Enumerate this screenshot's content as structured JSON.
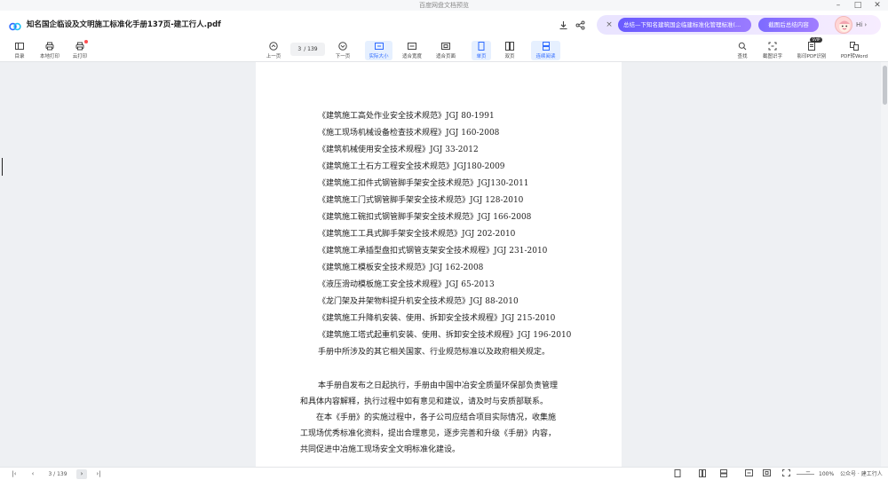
{
  "window": {
    "title": "百度网盘文档预览",
    "controls": [
      "–",
      "□",
      "✕"
    ]
  },
  "header": {
    "doc_title": "知名国企临设及文明施工标准化手册137页-建工行人.pdf",
    "download_icon": "download-icon",
    "share_icon": "share-icon"
  },
  "ai_banner": {
    "close": "×",
    "summary_chip": "总结—下知名建筑国企临建标准化管理标准(...",
    "screenshot_chip": "截图后总结内容",
    "greeting": "Hi ›"
  },
  "toolbar": {
    "left": [
      {
        "label": "目录",
        "icon": "list-icon"
      },
      {
        "label": "本地打印",
        "icon": "printer-icon"
      },
      {
        "label": "云打印",
        "icon": "cloud-print-icon"
      }
    ],
    "prev_label": "上一页",
    "page_current": "3",
    "page_total": "/ 139",
    "next_label": "下一页",
    "views": [
      {
        "label": "实际大小",
        "active": true
      },
      {
        "label": "适合宽度",
        "active": false
      },
      {
        "label": "适合页面",
        "active": false
      },
      {
        "label": "单页",
        "active": true
      },
      {
        "label": "双页",
        "active": false
      },
      {
        "label": "连续阅读",
        "active": true
      }
    ],
    "right": [
      {
        "label": "查找",
        "icon": "search-icon"
      },
      {
        "label": "截图识字",
        "icon": "ocr-icon"
      },
      {
        "label": "影印PDF识别",
        "icon": "scan-pdf-icon"
      },
      {
        "label": "PDF转Word",
        "icon": "pdf-to-word-icon"
      }
    ],
    "badge": "SVIP"
  },
  "document": {
    "lines": [
      "《建筑施工高处作业安全技术规范》JGJ 80-1991",
      "《施工现场机械设备检查技术规程》JGJ 160-2008",
      "《建筑机械使用安全技术规程》JGJ 33-2012",
      "《建筑施工土石方工程安全技术规范》JGJ180-2009",
      "《建筑施工扣件式钢管脚手架安全技术规范》JGJ130-2011",
      "《建筑施工门式钢管脚手架安全技术规范》JGJ 128-2010",
      "《建筑施工碗扣式钢管脚手架安全技术规范》JGJ 166-2008",
      "《建筑施工工具式脚手架安全技术规范》JGJ 202-2010",
      "《建筑施工承插型盘扣式钢管支架安全技术规程》JGJ 231-2010",
      "《建筑施工模板安全技术规范》JGJ 162-2008",
      "《液压滑动模板施工安全技术规程》JGJ 65-2013",
      "《龙门架及井架物料提升机安全技术规范》JGJ 88-2010",
      "《建筑施工升降机安装、使用、拆卸安全技术规程》JGJ 215-2010",
      "《建筑施工塔式起重机安装、使用、拆卸安全技术规程》JGJ 196-2010",
      "手册中所涉及的其它相关国家、行业规范标准以及政府相关规定。",
      "本手册自发布之日起执行，手册由中国中冶安全质量环保部负责管理",
      "和具体内容解释，执行过程中如有意见和建议，请及时与安质部联系。",
      "在本《手册》的实施过程中，各子公司应结合项目实际情况，收集施",
      "工现场优秀标准化资料，提出合理意见，逐步完善和升级《手册》内容，",
      "共同促进中冶施工现场安全文明标准化建设。"
    ]
  },
  "bottom": {
    "first": "|‹",
    "prev": "‹",
    "page": "3 / 139",
    "next": "›",
    "last": "›|",
    "zoom_minus": "−",
    "zoom_value": "100%",
    "watermark": "公众号 · 建工行人"
  }
}
